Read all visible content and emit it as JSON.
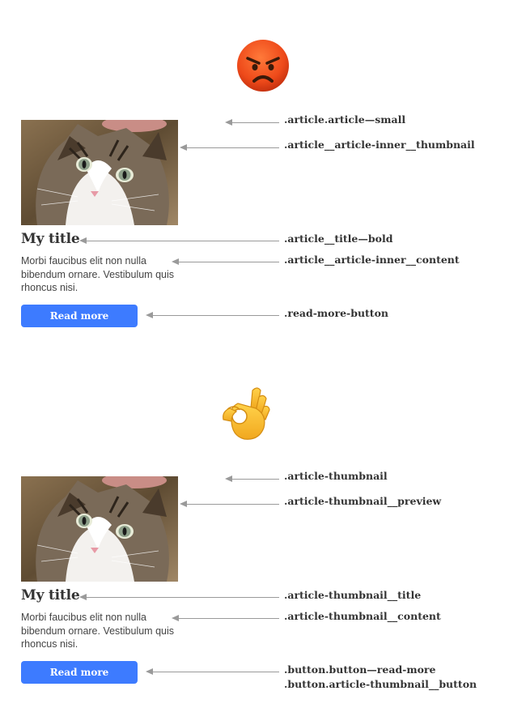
{
  "bad_example": {
    "emoji": "angry-face-icon",
    "card": {
      "title": "My title",
      "content": "Morbi faucibus elit non nulla bibendum ornare. Vestibulum quis rhoncus nisi.",
      "button": "Read more"
    },
    "labels": {
      "container": ".article.article—small",
      "thumbnail": ".article__article-inner__thumbnail",
      "title": ".article__title—bold",
      "content": ".article__article-inner__content",
      "button": ".read-more-button"
    }
  },
  "good_example": {
    "emoji": "ok-hand-icon",
    "card": {
      "title": "My title",
      "content": "Morbi faucibus elit non nulla bibendum ornare. Vestibulum quis rhoncus nisi.",
      "button": "Read more"
    },
    "labels": {
      "container": ".article-thumbnail",
      "thumbnail": ".article-thumbnail__preview",
      "title": ".article-thumbnail__title",
      "content": ".article-thumbnail__content",
      "button_line1": ".button.button—read-more",
      "button_line2": ".button.article-thumbnail__button"
    }
  },
  "colors": {
    "button": "#3d7bff",
    "arrow": "#9a9a9a",
    "angry_face": "#e8481c",
    "ok_hand": "#f7c13a"
  }
}
